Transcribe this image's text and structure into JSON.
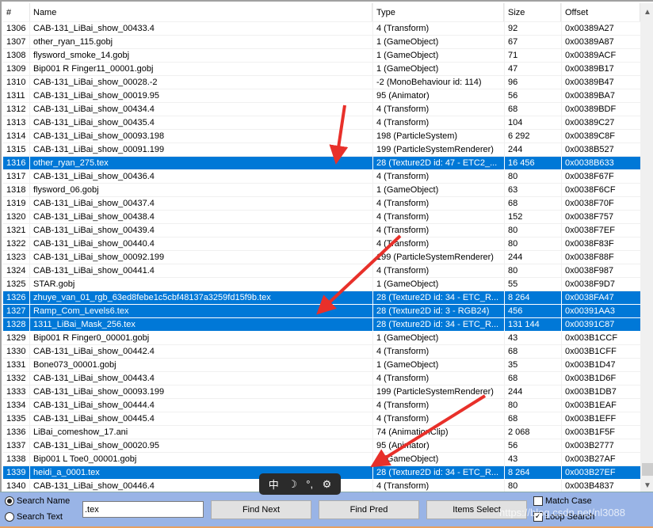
{
  "columns": [
    "#",
    "Name",
    "Type",
    "Size",
    "Offset"
  ],
  "rows": [
    [
      "1306",
      "CAB-131_LiBai_show_00433.4",
      "4 (Transform)",
      "92",
      "0x00389A27",
      false
    ],
    [
      "1307",
      "other_ryan_115.gobj",
      "1 (GameObject)",
      "67",
      "0x00389A87",
      false
    ],
    [
      "1308",
      "flysword_smoke_14.gobj",
      "1 (GameObject)",
      "71",
      "0x00389ACF",
      false
    ],
    [
      "1309",
      "Bip001 R Finger11_00001.gobj",
      "1 (GameObject)",
      "47",
      "0x00389B17",
      false
    ],
    [
      "1310",
      "CAB-131_LiBai_show_00028.-2",
      "-2 (MonoBehaviour id: 114)",
      "96",
      "0x00389B47",
      false
    ],
    [
      "1311",
      "CAB-131_LiBai_show_00019.95",
      "95 (Animator)",
      "56",
      "0x00389BA7",
      false
    ],
    [
      "1312",
      "CAB-131_LiBai_show_00434.4",
      "4 (Transform)",
      "68",
      "0x00389BDF",
      false
    ],
    [
      "1313",
      "CAB-131_LiBai_show_00435.4",
      "4 (Transform)",
      "104",
      "0x00389C27",
      false
    ],
    [
      "1314",
      "CAB-131_LiBai_show_00093.198",
      "198 (ParticleSystem)",
      "6 292",
      "0x00389C8F",
      false
    ],
    [
      "1315",
      "CAB-131_LiBai_show_00091.199",
      "199 (ParticleSystemRenderer)",
      "244",
      "0x0038B527",
      false
    ],
    [
      "1316",
      "other_ryan_275.tex",
      "28 (Texture2D id: 47 - ETC2_...",
      "16 456",
      "0x0038B633",
      true
    ],
    [
      "1317",
      "CAB-131_LiBai_show_00436.4",
      "4 (Transform)",
      "80",
      "0x0038F67F",
      false
    ],
    [
      "1318",
      "flysword_06.gobj",
      "1 (GameObject)",
      "63",
      "0x0038F6CF",
      false
    ],
    [
      "1319",
      "CAB-131_LiBai_show_00437.4",
      "4 (Transform)",
      "68",
      "0x0038F70F",
      false
    ],
    [
      "1320",
      "CAB-131_LiBai_show_00438.4",
      "4 (Transform)",
      "152",
      "0x0038F757",
      false
    ],
    [
      "1321",
      "CAB-131_LiBai_show_00439.4",
      "4 (Transform)",
      "80",
      "0x0038F7EF",
      false
    ],
    [
      "1322",
      "CAB-131_LiBai_show_00440.4",
      "4 (Transform)",
      "80",
      "0x0038F83F",
      false
    ],
    [
      "1323",
      "CAB-131_LiBai_show_00092.199",
      "199 (ParticleSystemRenderer)",
      "244",
      "0x0038F88F",
      false
    ],
    [
      "1324",
      "CAB-131_LiBai_show_00441.4",
      "4 (Transform)",
      "80",
      "0x0038F987",
      false
    ],
    [
      "1325",
      "STAR.gobj",
      "1 (GameObject)",
      "55",
      "0x0038F9D7",
      false
    ],
    [
      "1326",
      "zhuye_van_01_rgb_63ed8febe1c5cbf48137a3259fd15f9b.tex",
      "28 (Texture2D id: 34 - ETC_R...",
      "8 264",
      "0x0038FA47",
      true
    ],
    [
      "1327",
      "Ramp_Com_Levels6.tex",
      "28 (Texture2D id: 3 - RGB24)",
      "456",
      "0x00391AA3",
      true
    ],
    [
      "1328",
      "1311_LiBai_Mask_256.tex",
      "28 (Texture2D id: 34 - ETC_R...",
      "131 144",
      "0x00391C87",
      true
    ],
    [
      "1329",
      "Bip001 R Finger0_00001.gobj",
      "1 (GameObject)",
      "43",
      "0x003B1CCF",
      false
    ],
    [
      "1330",
      "CAB-131_LiBai_show_00442.4",
      "4 (Transform)",
      "68",
      "0x003B1CFF",
      false
    ],
    [
      "1331",
      "Bone073_00001.gobj",
      "1 (GameObject)",
      "35",
      "0x003B1D47",
      false
    ],
    [
      "1332",
      "CAB-131_LiBai_show_00443.4",
      "4 (Transform)",
      "68",
      "0x003B1D6F",
      false
    ],
    [
      "1333",
      "CAB-131_LiBai_show_00093.199",
      "199 (ParticleSystemRenderer)",
      "244",
      "0x003B1DB7",
      false
    ],
    [
      "1334",
      "CAB-131_LiBai_show_00444.4",
      "4 (Transform)",
      "80",
      "0x003B1EAF",
      false
    ],
    [
      "1335",
      "CAB-131_LiBai_show_00445.4",
      "4 (Transform)",
      "68",
      "0x003B1EFF",
      false
    ],
    [
      "1336",
      "LiBai_comeshow_17.ani",
      "74 (AnimationClip)",
      "2 068",
      "0x003B1F5F",
      false
    ],
    [
      "1337",
      "CAB-131_LiBai_show_00020.95",
      "95 (Animator)",
      "56",
      "0x003B2777",
      false
    ],
    [
      "1338",
      "Bip001 L Toe0_00001.gobj",
      "1 (GameObject)",
      "43",
      "0x003B27AF",
      false
    ],
    [
      "1339",
      "heidi_a_0001.tex",
      "28 (Texture2D id: 34 - ETC_R...",
      "8 264",
      "0x003B27EF",
      true
    ],
    [
      "1340",
      "CAB-131_LiBai_show_00446.4",
      "4 (Transform)",
      "80",
      "0x003B4837",
      false
    ]
  ],
  "search": {
    "name_label": "Search Name",
    "text_label": "Search Text",
    "mode": "name",
    "value": ".tex"
  },
  "buttons": {
    "find_next": "Find Next",
    "find_pred": "Find Pred",
    "items_select": "Items Select"
  },
  "options": {
    "match_case": "Match Case",
    "match_case_checked": false,
    "loop_search": "Loop Search",
    "loop_search_checked": true
  },
  "watermark": "https://blog.csdn.net/nl3088",
  "ime": {
    "lang": "中",
    "moon": "☽",
    "punct": "°,",
    "gear": "⚙"
  },
  "colors": {
    "selection": "#0078d7",
    "panel": "#99b4e6",
    "arrow": "#e8302a"
  }
}
